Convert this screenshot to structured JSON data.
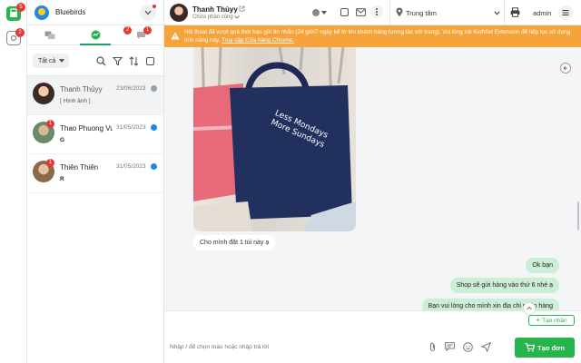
{
  "rail": {
    "badges": [
      "5",
      "2"
    ]
  },
  "page": {
    "name": "Bluebirds"
  },
  "tabs": [
    {
      "id": "messenger",
      "badge": ""
    },
    {
      "id": "zalo",
      "badge": "2"
    },
    {
      "id": "comments",
      "badge": "1"
    }
  ],
  "filters": {
    "dropdown_label": "Tất cả"
  },
  "conversations": [
    {
      "name": "Thanh Thủyy",
      "date": "23/06/2023",
      "preview": "[ Hình ảnh ]",
      "unread": "",
      "active": true
    },
    {
      "name": "Thao Phuong Vu",
      "date": "31/05/2023",
      "preview": "G",
      "unread": "1",
      "active": false
    },
    {
      "name": "Thiên Thiên",
      "date": "31/05/2023",
      "preview": "R",
      "unread": "1",
      "active": false
    }
  ],
  "header": {
    "contact_name": "Thanh Thủyy",
    "contact_status": "Chưa phân công",
    "branch": "Trung tâm",
    "user": "admin"
  },
  "warning": {
    "text": "Hội thoại đã vượt quá thời hạn gửi tin nhắn (24 giờ/7 ngày kể từ khi khách hàng tương tác với trang). Vui lòng cài KiotViet Extension để tiếp tục sử dụng tính năng này.",
    "link": "Truy cập Cửa hàng Chrome."
  },
  "image_caption": {
    "line1": "Less Mondays",
    "line2": "More Sundays"
  },
  "messages": {
    "incoming": "Cho mình đặt 1 túi này ạ",
    "outgoing": [
      "Ok bạn",
      "Shop sẽ gửi hàng vào thứ 6 nhé ạ",
      "Bạn vui lòng cho mình xin địa chỉ nhận hàng"
    ]
  },
  "composer": {
    "tag_button": "Tạo nhãn",
    "placeholder": "Nhập / để chọn mẫu hoặc nhập trả lời",
    "create_order": "Tạo đơn"
  },
  "colors": {
    "accent": "#27b34e",
    "warning": "#f7a33b",
    "badge": "#e53935",
    "outgoing_bubble": "#cdeed6"
  }
}
